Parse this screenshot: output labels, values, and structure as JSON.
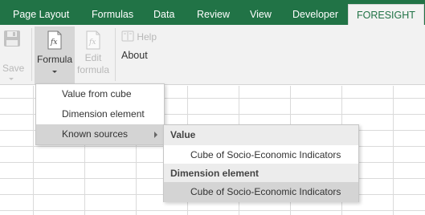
{
  "tabs": {
    "page_layout": "Page Layout",
    "formulas": "Formulas",
    "data": "Data",
    "review": "Review",
    "view": "View",
    "developer": "Developer",
    "foresight": "FORESIGHT"
  },
  "ribbon": {
    "save": "Save",
    "formula": "Formula",
    "edit_line1": "Edit",
    "edit_line2": "formula",
    "help": "Help",
    "about": "About",
    "fx_glyph": "fx"
  },
  "formula_menu": {
    "value_from_cube": "Value from cube",
    "dimension_element": "Dimension element",
    "known_sources": "Known sources"
  },
  "known_sources_menu": {
    "value_header": "Value",
    "value_item": "Cube of Socio-Economic Indicators",
    "dimension_header": "Dimension element",
    "dimension_item": "Cube of Socio-Economic Indicators"
  },
  "colors": {
    "accent_green": "#217346",
    "ribbon_bg": "#f2f2f2",
    "highlight": "#d4d4d4"
  },
  "icons": [
    "save-icon",
    "formula-fx-icon",
    "edit-formula-icon",
    "help-icon",
    "submenu-arrow-icon",
    "dropdown-caret-icon"
  ]
}
